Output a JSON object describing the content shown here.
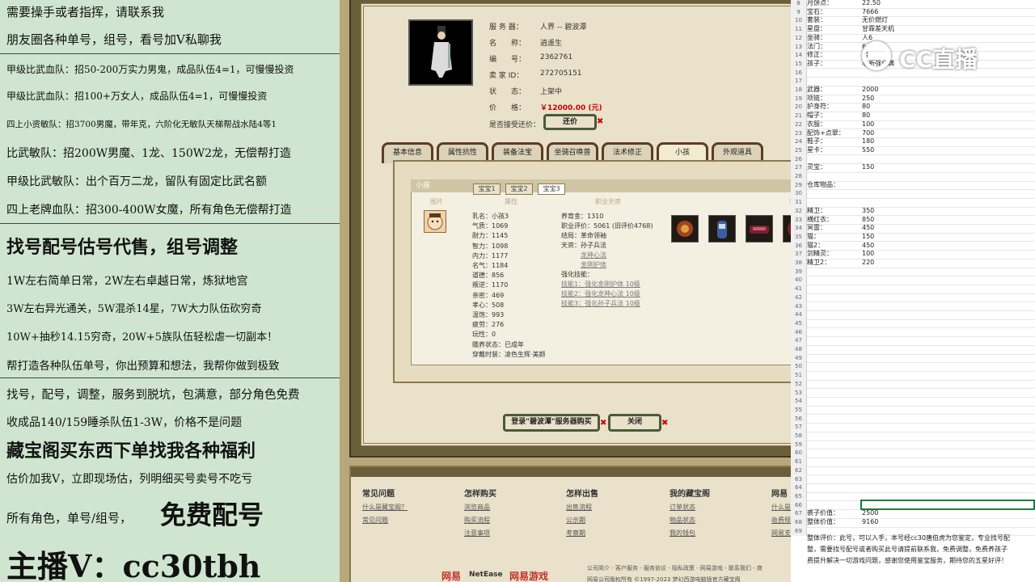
{
  "left_banner": {
    "lines": [
      "需要操手或者指挥，请联系我",
      "朋友圈各种单号，组号，看号加V私聊我",
      "甲级比武血队：招50-200万实力男鬼，成品队伍4=1，可慢慢投资",
      "甲级比武血队：招100+万女人，成品队伍4=1，可慢慢投资",
      "四上小资敏队：招3700男魔，带年克，六阶化无敏队天梯帮战水陆4等1",
      "比武敏队：招200W男魔、1龙、150W2龙，无偿帮打造",
      "甲级比武敏队：出个百万二龙，留队有固定比武名额",
      "四上老牌血队：招300-400W女魔，所有角色无偿帮打造",
      "找号配号估号代售，组号调整",
      "1W左右简单日常，2W左右卓越日常，炼狱地宫",
      "3W左右异光通关，5W混杀14星，7W大力队伍砍穷奇",
      "10W+抽秒14.15穷奇，20W+5族队伍轻松虐一切副本！",
      "帮打造各种队伍单号，你出预算和想法，我帮你做到极致",
      "找号，配号，调整，服务到脱坑，包满意，部分角色免费",
      "收成品140/159睡杀队伍1-3W，价格不是问题",
      "藏宝阁买东西下单找我各种福利",
      "估价加我V，立即现场估，列明细买号卖号不吃亏",
      "所有角色，单号/组号，",
      "免费配号",
      "主播V：cc30tbh"
    ]
  },
  "game": {
    "info_labels": [
      "服 务 器：",
      "名　　称：",
      "编　　号：",
      "卖 家 ID：",
      "状　　态：",
      "价　　格："
    ],
    "info_values": [
      "人界 -- 碧波潭",
      "逍遥生",
      "2362761",
      "272705151",
      "上架中",
      "￥12000.00 (元)"
    ],
    "bargain_label": "是否接受还价：",
    "bargain_button": "还价",
    "tabs": [
      "基本信息",
      "属性抗性",
      "装备法宝",
      "坐骑召唤兽",
      "法术修正",
      "小孩",
      "外观道具"
    ],
    "panel_title": "小孩",
    "subtabs": [
      "宝宝1",
      "宝宝2",
      "宝宝3"
    ],
    "col_heads": [
      "图片",
      "属性",
      "职业天资",
      "装备"
    ],
    "child_stats": [
      "乳名：小孩3",
      "气质：1069",
      "耐力：1145",
      "智力：1098",
      "内力：1177",
      "名气：1184",
      "道德：856",
      "叛逆：1170",
      "亲密：469",
      "孝心：508",
      "温饱：993",
      "疲劳：276",
      "玩性：0",
      "赡养状态：已成年",
      "穿戴时装：凌色生辉·美颜"
    ],
    "child_info": [
      "养育金：1310",
      "职业评价：5061 (旧评价4768)",
      "结局：革命领袖",
      "天资：孙子兵法"
    ],
    "child_links": [
      "龙神心法",
      "金刚护体"
    ],
    "skills_title": "强化技能：",
    "skills": [
      "技能1：强化金刚护体 10级",
      "技能2：强化龙神心法 10级",
      "技能3：强化孙子兵法 10级"
    ],
    "buy_button": "登录\"碧波潭\"服务器购买",
    "close_button": "关闭",
    "footer_heads": [
      "常见问题",
      "怎样购买",
      "怎样出售",
      "我的藏宝阁",
      "网易"
    ],
    "footer_links": [
      [
        "什么是藏宝阁？",
        "常见问题"
      ],
      [
        "浏览商品",
        "购买流程",
        "注意事项"
      ],
      [
        "出售流程",
        "公示期",
        "考察期"
      ],
      [
        "订单状态",
        "物品状态",
        "我的钱包"
      ],
      [
        "什么是",
        "收费规",
        "网易支"
      ]
    ],
    "footer_bottom": [
      "公司简介 - 客户服务 - 服务协议 - 隐私政策 - 网易游戏 - 联系我们 - 商",
      "网易公司版权所有 ©1997-2023 梦幻西游电脑版官方藏宝阁"
    ],
    "brand_netease": "NetEase",
    "brand_game": "网易游戏",
    "brand_logo": "网易"
  },
  "sheet": {
    "watermark": "CC直播",
    "rows": [
      {
        "n": "8",
        "l": "月饼点：",
        "v": "22.50"
      },
      {
        "n": "9",
        "l": "宝石：",
        "v": "7666"
      },
      {
        "n": "10",
        "l": "套装：",
        "v": "无价燃灯"
      },
      {
        "n": "11",
        "l": "星盘：",
        "v": "甘霖差天机"
      },
      {
        "n": "12",
        "l": "坐骑：",
        "v": "人6"
      },
      {
        "n": "13",
        "l": "法门：",
        "v": "6"
      },
      {
        "n": "14",
        "l": "修正：",
        "v": "男"
      },
      {
        "n": "15",
        "l": "孩子：",
        "v": "老新强化满"
      },
      {
        "n": "16",
        "l": "",
        "v": ""
      },
      {
        "n": "17",
        "l": "",
        "v": ""
      },
      {
        "n": "18",
        "l": "武器：",
        "v": "2000"
      },
      {
        "n": "19",
        "l": "项链：",
        "v": "250"
      },
      {
        "n": "20",
        "l": "护身符：",
        "v": "80"
      },
      {
        "n": "21",
        "l": "帽子：",
        "v": "80"
      },
      {
        "n": "22",
        "l": "衣服：",
        "v": "100"
      },
      {
        "n": "23",
        "l": "配饰+点翠：",
        "v": "700"
      },
      {
        "n": "24",
        "l": "鞋子：",
        "v": "180"
      },
      {
        "n": "25",
        "l": "星卡：",
        "v": "550"
      },
      {
        "n": "26",
        "l": "",
        "v": ""
      },
      {
        "n": "27",
        "l": "灵宝：",
        "v": "150"
      },
      {
        "n": "28",
        "l": "",
        "v": ""
      },
      {
        "n": "29",
        "l": "仓库物品：",
        "v": ""
      },
      {
        "n": "30",
        "l": "",
        "v": ""
      },
      {
        "n": "31",
        "l": "",
        "v": ""
      },
      {
        "n": "32",
        "l": "精卫：",
        "v": "350"
      },
      {
        "n": "33",
        "l": "横红衣：",
        "v": "850"
      },
      {
        "n": "34",
        "l": "冥雷：",
        "v": "450"
      },
      {
        "n": "35",
        "l": "猫：",
        "v": "150"
      },
      {
        "n": "36",
        "l": "猫2：",
        "v": "450"
      },
      {
        "n": "37",
        "l": "剑精灵：",
        "v": "100"
      },
      {
        "n": "38",
        "l": "精卫2：",
        "v": "220"
      },
      {
        "n": "39",
        "l": "",
        "v": ""
      },
      {
        "n": "40",
        "l": "",
        "v": ""
      },
      {
        "n": "41",
        "l": "",
        "v": ""
      },
      {
        "n": "42",
        "l": "",
        "v": ""
      },
      {
        "n": "43",
        "l": "",
        "v": ""
      },
      {
        "n": "44",
        "l": "",
        "v": ""
      },
      {
        "n": "45",
        "l": "",
        "v": ""
      },
      {
        "n": "46",
        "l": "",
        "v": ""
      },
      {
        "n": "47",
        "l": "",
        "v": ""
      },
      {
        "n": "48",
        "l": "",
        "v": ""
      },
      {
        "n": "49",
        "l": "",
        "v": ""
      },
      {
        "n": "50",
        "l": "",
        "v": ""
      },
      {
        "n": "51",
        "l": "",
        "v": ""
      },
      {
        "n": "52",
        "l": "",
        "v": ""
      },
      {
        "n": "53",
        "l": "",
        "v": ""
      },
      {
        "n": "54",
        "l": "",
        "v": ""
      },
      {
        "n": "55",
        "l": "",
        "v": ""
      },
      {
        "n": "56",
        "l": "",
        "v": ""
      },
      {
        "n": "57",
        "l": "",
        "v": ""
      },
      {
        "n": "58",
        "l": "",
        "v": ""
      },
      {
        "n": "59",
        "l": "",
        "v": ""
      },
      {
        "n": "60",
        "l": "",
        "v": ""
      },
      {
        "n": "61",
        "l": "",
        "v": ""
      },
      {
        "n": "62",
        "l": "",
        "v": ""
      },
      {
        "n": "63",
        "l": "",
        "v": ""
      },
      {
        "n": "64",
        "l": "",
        "v": ""
      },
      {
        "n": "65",
        "l": "",
        "v": ""
      },
      {
        "n": "66",
        "l": "",
        "v": ""
      },
      {
        "n": "67",
        "l": "裘子价值：",
        "v": "2500"
      },
      {
        "n": "68",
        "l": "整体价值：",
        "v": "9160"
      },
      {
        "n": "69",
        "l": "",
        "v": ""
      }
    ],
    "notes": [
      "整体评价：此号，可以入手，本号经cc30唐伯虎为您鉴定，专业找号配",
      "整，需要找号配号或者购买此号请提前联系我，免费调整，免费养孩子",
      "费提升解决一切游戏问题，感谢您使用鉴宝服务，期待您的五星好评！"
    ]
  }
}
